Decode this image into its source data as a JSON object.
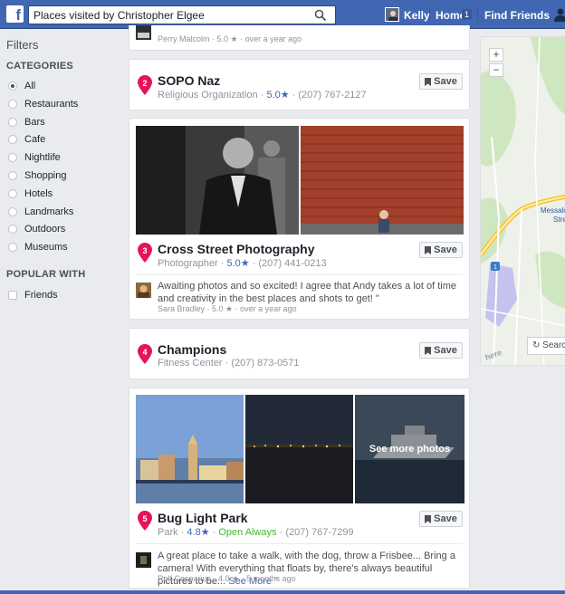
{
  "topbar": {
    "logo": "f",
    "search_value": "Places visited by Christopher Elgee",
    "user_name": "Kelly",
    "home_label": "Home",
    "home_badge": "1",
    "find_friends_label": "Find Friends"
  },
  "sidebar": {
    "filters_title": "Filters",
    "categories_title": "CATEGORIES",
    "categories": [
      "All",
      "Restaurants",
      "Bars",
      "Cafe",
      "Nightlife",
      "Shopping",
      "Hotels",
      "Landmarks",
      "Outdoors",
      "Museums"
    ],
    "selected_category": "All",
    "popular_title": "POPULAR WITH",
    "popular_items": [
      "Friends"
    ]
  },
  "save_label": "Save",
  "partial_review": {
    "author": "Perry Malcolm",
    "rating": "5.0 ★",
    "time": "over a year ago"
  },
  "places": [
    {
      "number": "2",
      "name": "SOPO Naz",
      "category": "Religious Organization",
      "rating": "5.0★",
      "phone": "(207) 767-2127"
    },
    {
      "number": "3",
      "name": "Cross Street Photography",
      "category": "Photographer",
      "rating": "5.0★",
      "phone": "(207) 441-0213",
      "review": {
        "text": "Awaiting photos and so excited! I agree that Andy takes a lot of time and creativity in the best places and shots to get! \"",
        "author": "Sara Bradley",
        "rating": "5.0 ★",
        "time": "over a year ago"
      }
    },
    {
      "number": "4",
      "name": "Champions",
      "category": "Fitness Center",
      "phone": "(207) 873-0571"
    },
    {
      "number": "5",
      "name": "Bug Light Park",
      "category": "Park",
      "rating": "4.8★",
      "status": "Open Always",
      "phone": "(207) 767-7299",
      "review": {
        "text": "A great place to take a walk, with the dog, throw a Frisbee... Bring a camera! With everything that floats by, there's always beautiful pictures to be...",
        "see_more": "See More \"",
        "author": "Rolf Casparius",
        "rating": "4.0 ★",
        "time": "5 months ago"
      },
      "see_more_photos": "See more photos"
    }
  ],
  "map": {
    "zoom_in": "+",
    "zoom_out": "−",
    "label_line1": "Messalo",
    "label_line2": "Stre",
    "route": "1",
    "attribution": "here",
    "search_label": "Searc"
  },
  "colors": {
    "brand": "#4267b2",
    "pin": "#e4135e",
    "rating": "#4267b2",
    "open": "#42b72a"
  }
}
